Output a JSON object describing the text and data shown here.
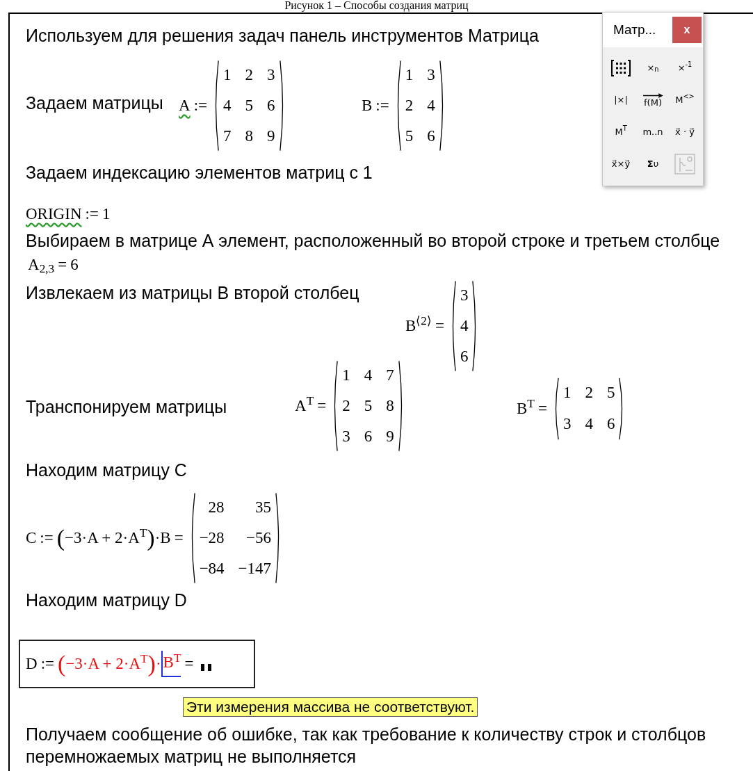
{
  "caption": "Рисунок 1 – Способы создания матриц",
  "toolbar": {
    "title": "Матр...",
    "close": "x",
    "buttons": [
      {
        "kind": "grid",
        "disabled": false
      },
      {
        "kind": "text",
        "label": "×$_{n}$",
        "disabled": false
      },
      {
        "kind": "text",
        "label": "×$^{-1}$",
        "disabled": false
      },
      {
        "kind": "text",
        "label": "|×|",
        "disabled": false
      },
      {
        "kind": "vector",
        "label": "f(M)",
        "disabled": false
      },
      {
        "kind": "text",
        "label": "M$^{<>}$",
        "disabled": false
      },
      {
        "kind": "text",
        "label": "M$^{T}$",
        "disabled": false
      },
      {
        "kind": "text",
        "label": "m..n",
        "disabled": false
      },
      {
        "kind": "text",
        "label": "x⃗ · y⃗",
        "disabled": false
      },
      {
        "kind": "text",
        "label": "x⃗×y⃗",
        "disabled": false
      },
      {
        "kind": "text",
        "label": "**Σ**υ",
        "disabled": false
      },
      {
        "kind": "plot",
        "disabled": true
      }
    ]
  },
  "regions": [
    {
      "kind": "text",
      "text": "Используем для решения задач панель инструментов Матрица"
    },
    {
      "kind": "text",
      "text": "Задаем матрицы"
    },
    {
      "kind": "math",
      "selected": false,
      "tokens": [
        {
          "kind": "sym",
          "text": "A",
          "warning": true
        },
        {
          "kind": "op",
          "text": ":="
        },
        {
          "kind": "matrix",
          "rows": [
            [
              "1",
              "2",
              "3"
            ],
            [
              "4",
              "5",
              "6"
            ],
            [
              "7",
              "8",
              "9"
            ]
          ]
        }
      ]
    },
    {
      "kind": "math",
      "selected": false,
      "tokens": [
        {
          "kind": "sym",
          "text": "B",
          "warning": false
        },
        {
          "kind": "op",
          "text": ":="
        },
        {
          "kind": "matrix",
          "rows": [
            [
              "1",
              "3"
            ],
            [
              "2",
              "4"
            ],
            [
              "5",
              "6"
            ]
          ]
        }
      ]
    },
    {
      "kind": "text",
      "text": "Задаем индексацию элементов матриц с 1"
    },
    {
      "kind": "math",
      "selected": false,
      "tokens": [
        {
          "kind": "sym",
          "text": "ORIGIN",
          "warning": true
        },
        {
          "kind": "op",
          "text": ":="
        },
        {
          "kind": "sym",
          "text": "1",
          "warning": false
        }
      ]
    },
    {
      "kind": "text",
      "text": "Выбираем в матрице А элемент, расположенный во второй строке и третьем столбце"
    },
    {
      "kind": "math",
      "selected": false,
      "tokens": [
        {
          "kind": "sym",
          "text": "A$_{2,3}$",
          "warning": false
        },
        {
          "kind": "op",
          "text": "="
        },
        {
          "kind": "sym",
          "text": "6",
          "warning": false
        }
      ]
    },
    {
      "kind": "text",
      "text": "Извлекаем из матрицы B второй столбец"
    },
    {
      "kind": "math",
      "selected": false,
      "tokens": [
        {
          "kind": "sym",
          "text": "B$^{⟨2⟩}$",
          "warning": false
        },
        {
          "kind": "op",
          "text": "="
        },
        {
          "kind": "matrix",
          "rows": [
            [
              "3"
            ],
            [
              "4"
            ],
            [
              "6"
            ]
          ]
        }
      ]
    },
    {
      "kind": "text",
      "text": "Транспонируем матрицы"
    },
    {
      "kind": "math",
      "selected": false,
      "tokens": [
        {
          "kind": "sym",
          "text": "A$^{T}$",
          "warning": false
        },
        {
          "kind": "op",
          "text": "="
        },
        {
          "kind": "matrix",
          "rows": [
            [
              "1",
              "4",
              "7"
            ],
            [
              "2",
              "5",
              "8"
            ],
            [
              "3",
              "6",
              "9"
            ]
          ]
        }
      ]
    },
    {
      "kind": "math",
      "selected": false,
      "tokens": [
        {
          "kind": "sym",
          "text": "B$^{T}$",
          "warning": false
        },
        {
          "kind": "op",
          "text": "="
        },
        {
          "kind": "matrix",
          "rows": [
            [
              "1",
              "2",
              "5"
            ],
            [
              "3",
              "4",
              "6"
            ]
          ]
        }
      ]
    },
    {
      "kind": "text",
      "text": "Находим матрицу C"
    },
    {
      "kind": "math",
      "selected": false,
      "tokens": [
        {
          "kind": "sym",
          "text": "C",
          "warning": false
        },
        {
          "kind": "op",
          "text": ":="
        },
        {
          "kind": "paren",
          "text": "(",
          "error": false
        },
        {
          "kind": "expr",
          "text": "−3·A + 2·A$^{T}$",
          "error": false
        },
        {
          "kind": "paren",
          "text": ")",
          "error": false
        },
        {
          "kind": "expr",
          "text": "·B",
          "error": false
        },
        {
          "kind": "op",
          "text": "="
        },
        {
          "kind": "matrix",
          "rows": [
            [
              "28",
              "35"
            ],
            [
              "−28",
              "−56"
            ],
            [
              "−84",
              "−147"
            ]
          ]
        }
      ]
    },
    {
      "kind": "text",
      "text": "Находим матрицу D"
    },
    {
      "kind": "math",
      "selected": true,
      "tokens": [
        {
          "kind": "sym",
          "text": "D",
          "warning": false
        },
        {
          "kind": "op",
          "text": ":="
        },
        {
          "kind": "paren",
          "text": "(",
          "error": true
        },
        {
          "kind": "expr",
          "text": "−3·A + 2·A$^{T}$",
          "error": true
        },
        {
          "kind": "paren",
          "text": ")",
          "error": true
        },
        {
          "kind": "expr",
          "text": "·",
          "error": true
        },
        {
          "kind": "expr",
          "text": "B$^{T}$",
          "error": true,
          "cursor": true
        },
        {
          "kind": "op",
          "text": "="
        },
        {
          "kind": "placeholder"
        }
      ]
    },
    {
      "kind": "tooltip",
      "text": "Эти измерения массива не соответствуют."
    },
    {
      "kind": "text",
      "text": "Получаем сообщение об ошибке, так как требование к количеству строк и столбцов перемножаемых матриц не выполняется"
    }
  ]
}
